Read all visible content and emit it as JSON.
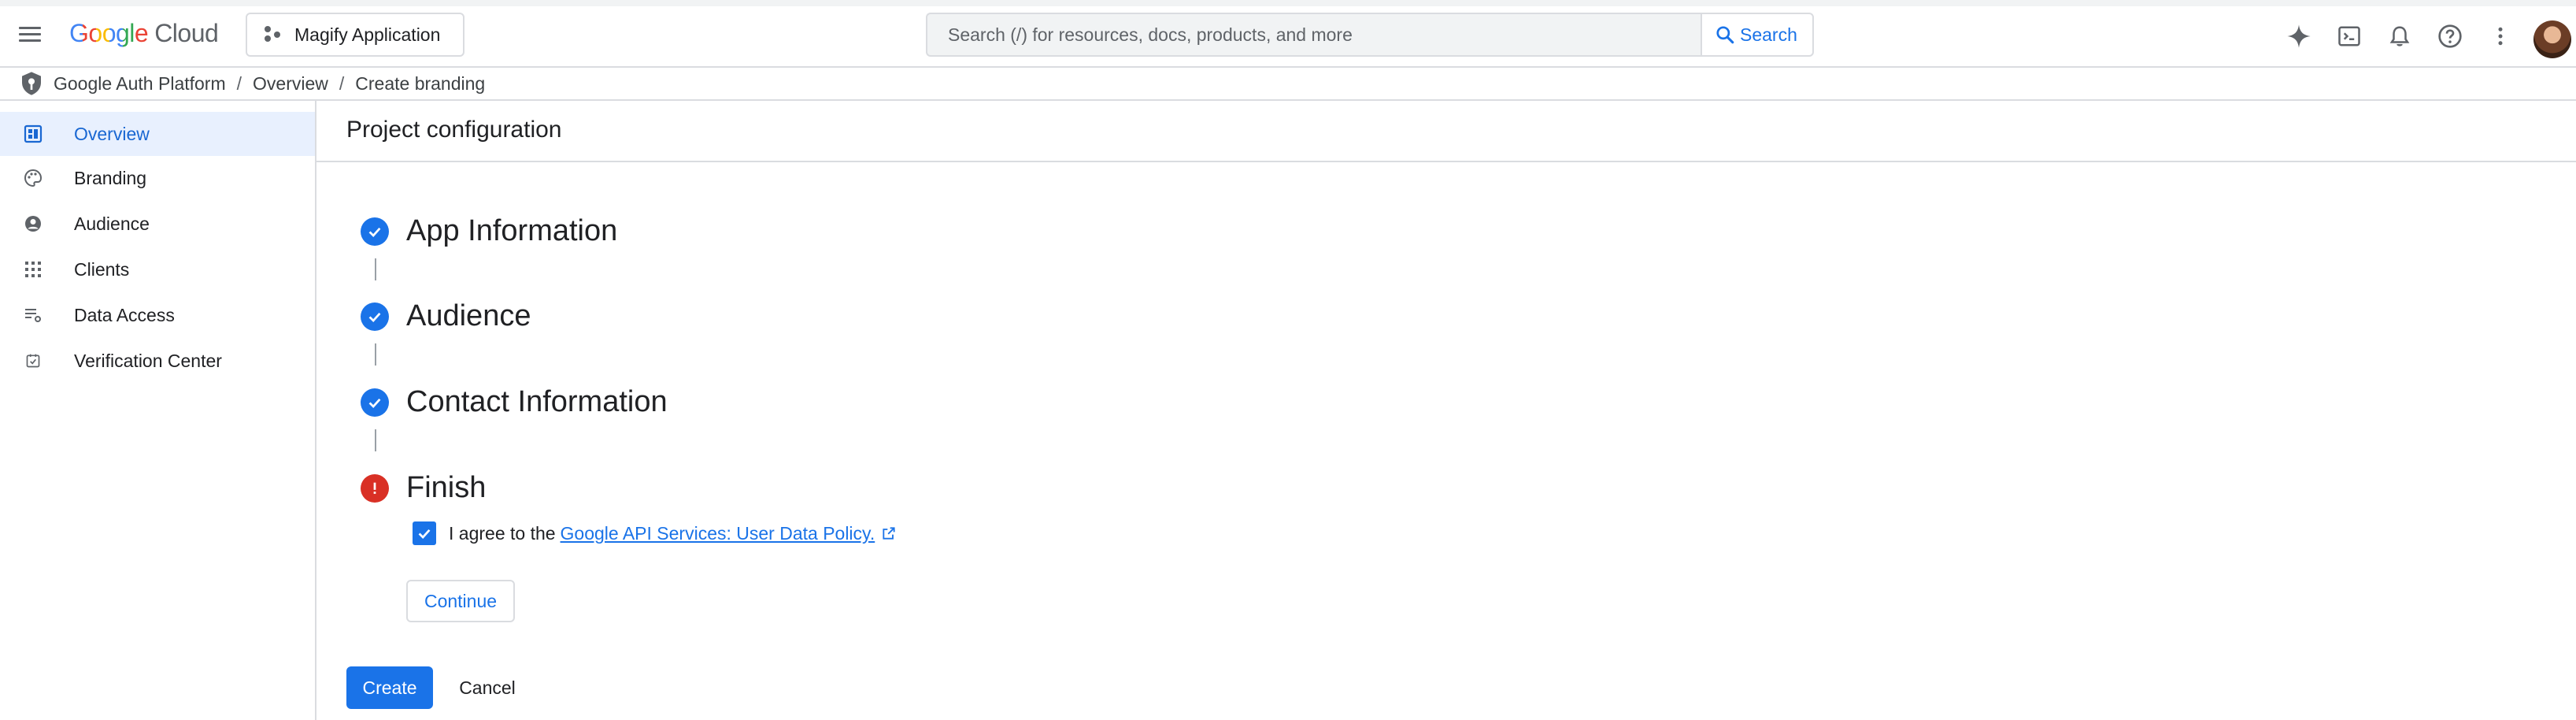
{
  "header": {
    "logo_google": "Google",
    "logo_cloud": "Cloud",
    "project_name": "Magify Application",
    "search_placeholder": "Search (/) for resources, docs, products, and more",
    "search_button_label": "Search",
    "icons": [
      "gemini-icon",
      "cloud-shell-icon",
      "notifications-icon",
      "help-icon",
      "more-vert-icon"
    ]
  },
  "breadcrumb": {
    "items": [
      "Google Auth Platform",
      "Overview",
      "Create branding"
    ],
    "separator": "/"
  },
  "sidebar": {
    "items": [
      {
        "label": "Overview",
        "icon": "dashboard-icon",
        "active": true
      },
      {
        "label": "Branding",
        "icon": "palette-icon",
        "active": false
      },
      {
        "label": "Audience",
        "icon": "account-circle-icon",
        "active": false
      },
      {
        "label": "Clients",
        "icon": "apps-grid-icon",
        "active": false
      },
      {
        "label": "Data Access",
        "icon": "data-access-icon",
        "active": false
      },
      {
        "label": "Verification Center",
        "icon": "verified-check-icon",
        "active": false
      }
    ]
  },
  "main": {
    "title": "Project configuration",
    "steps": [
      {
        "label": "App Information",
        "status": "complete"
      },
      {
        "label": "Audience",
        "status": "complete"
      },
      {
        "label": "Contact Information",
        "status": "complete"
      },
      {
        "label": "Finish",
        "status": "error"
      }
    ],
    "agree_text": "I agree to the",
    "agree_link": "Google API Services: User Data Policy.",
    "agree_checked": true,
    "continue_label": "Continue",
    "create_label": "Create",
    "cancel_label": "Cancel"
  },
  "colors": {
    "accent": "#1a73e8",
    "active_nav_bg": "#e8f0fe",
    "error": "#d93025",
    "border": "#dadce0"
  }
}
